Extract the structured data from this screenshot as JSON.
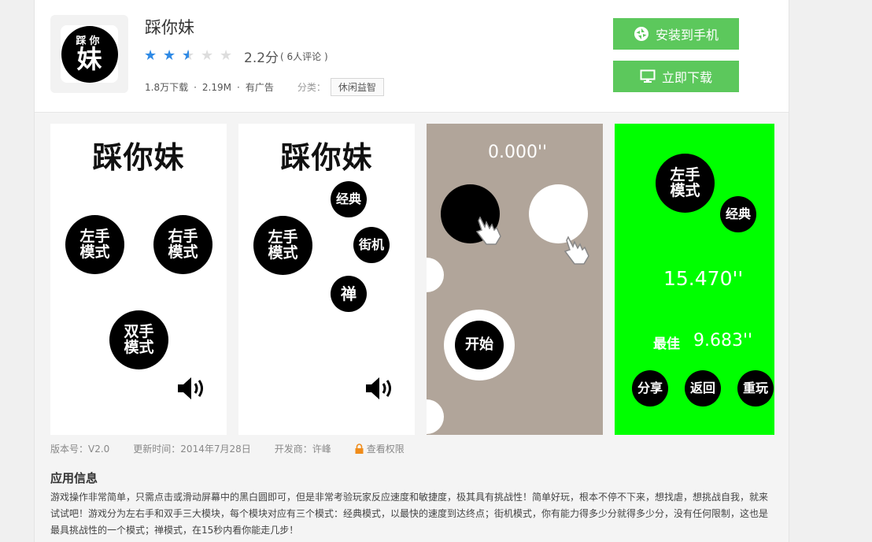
{
  "app": {
    "name": "踩你妹",
    "icon_text_top": "踩你",
    "icon_text_main": "妹",
    "rating": 2.5,
    "score": "2.2分",
    "reviews": "( 6人评论 )",
    "downloads": "1.8万下载",
    "dot1": "·",
    "size": "2.19M",
    "dot2": "·",
    "ads": "有广告",
    "category_label": "分类：",
    "category": "休闲益智"
  },
  "buttons": {
    "install": "安装到手机",
    "download": "立即下载",
    "accent": "#5cc85c"
  },
  "screenshots": {
    "s1": {
      "title": "踩你妹",
      "left_mode": "左手\n模式",
      "right_mode": "右手\n模式",
      "both_mode": "双手\n模式",
      "icon": "speaker-icon"
    },
    "s2": {
      "title": "踩你妹",
      "left_mode": "左手\n模式",
      "classic": "经典",
      "arcade": "街机",
      "zen": "禅",
      "icon": "speaker-icon"
    },
    "s3": {
      "timer": "0.000''",
      "start": "开始",
      "icon": "hand-pointer-icon"
    },
    "s4": {
      "left_mode": "左手\n模式",
      "classic": "经典",
      "time": "15.470''",
      "best_label": "最佳",
      "best_time": "9.683''",
      "share": "分享",
      "back": "返回",
      "replay": "重玩"
    }
  },
  "footer": {
    "version": "版本号：V2.0",
    "updated": "更新时间：2014年7月28日",
    "developer": "开发商：许峰",
    "permissions": "查看权限"
  },
  "info": {
    "title": "应用信息",
    "text": "游戏操作非常简单，只需点击或滑动屏幕中的黑白圆即可，但是非常考验玩家反应速度和敏捷度，极其具有挑战性！简单好玩，根本不停不下来，想找虐，想挑战自我，就来试试吧！游戏分为左右手和双手三大模块，每个模块对应有三个模式：经典模式，以最快的速度到达终点；街机模式，你有能力得多少分就得多少分，没有任何限制，这也是最具挑战性的一个模式；禅模式，在15秒内看你能走几步！"
  }
}
